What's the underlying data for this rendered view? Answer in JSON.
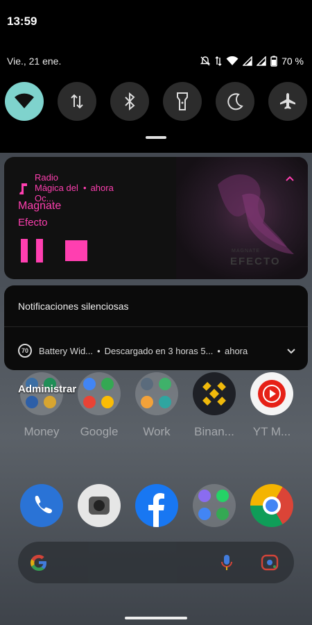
{
  "status": {
    "time": "13:59",
    "date": "Vie., 21 ene.",
    "battery": "70 %"
  },
  "quick_settings": [
    {
      "name": "wifi",
      "active": true
    },
    {
      "name": "mobile-data",
      "active": false
    },
    {
      "name": "bluetooth",
      "active": false
    },
    {
      "name": "flashlight",
      "active": false
    },
    {
      "name": "dark-mode",
      "active": false
    },
    {
      "name": "airplane-mode",
      "active": false
    }
  ],
  "media": {
    "app_name": "Radio Mágica del Oc...",
    "separator": "•",
    "time": "ahora",
    "title": "Magnate",
    "artist": "Efecto",
    "art_text": "EFECTO",
    "art_small": "MAGNATE",
    "accent": "#ff3fb0"
  },
  "silent": {
    "header": "Notificaciones silenciosas",
    "battery_badge": "70",
    "battery_app": "Battery Wid...",
    "battery_text": "Descargado en 3 horas 5...",
    "battery_time": "ahora",
    "separator": "•"
  },
  "manage_label": "Administrar",
  "apps_row1": [
    {
      "label": "Money"
    },
    {
      "label": "Google"
    },
    {
      "label": "Work"
    },
    {
      "label": "Binan..."
    },
    {
      "label": "YT M..."
    }
  ],
  "dock": [
    "phone",
    "camera",
    "facebook",
    "messaging-folder",
    "chrome"
  ]
}
